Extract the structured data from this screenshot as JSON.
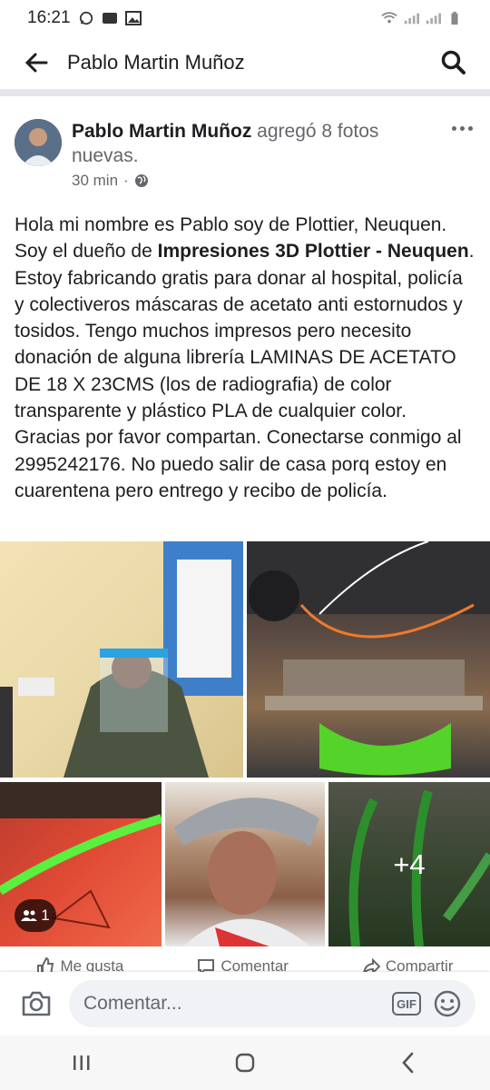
{
  "status_bar": {
    "time": "16:21"
  },
  "header": {
    "title": "Pablo Martin Muñoz"
  },
  "post": {
    "author": "Pablo Martin Muñoz",
    "action": "agregó 8 fotos nuevas.",
    "time": "30 min",
    "privacy_icon": "globe-icon",
    "text_part1": "Hola mi nombre es Pablo soy de Plottier, Neuquen. Soy el dueño de ",
    "text_bold": "Impresiones 3D Plottier - Neuquen",
    "text_part2": ". Estoy fabricando gratis para donar al hospital, policía y colectiveros máscaras de acetato anti estornudos y tosidos. Tengo muchos impresos pero necesito donación de alguna librería LAMINAS DE ACETATO DE 18 X 23CMS (los de radiografia) de color transparente y plástico PLA de cualquier color. Gracias por favor compartan. Conectarse conmigo al 2995242176. No puedo salir de casa porq estoy en cuarentena pero entrego y recibo de policía.",
    "photos": {
      "more_count": "+4",
      "tag_count": "1"
    }
  },
  "actions": {
    "like": "Me gusta",
    "comment": "Comentar",
    "share": "Compartir"
  },
  "comment_bar": {
    "placeholder": "Comentar...",
    "gif_label": "GIF"
  },
  "colors": {
    "text": "#1c1e21",
    "secondary": "#65676b",
    "input_bg": "#f0f2f5"
  }
}
